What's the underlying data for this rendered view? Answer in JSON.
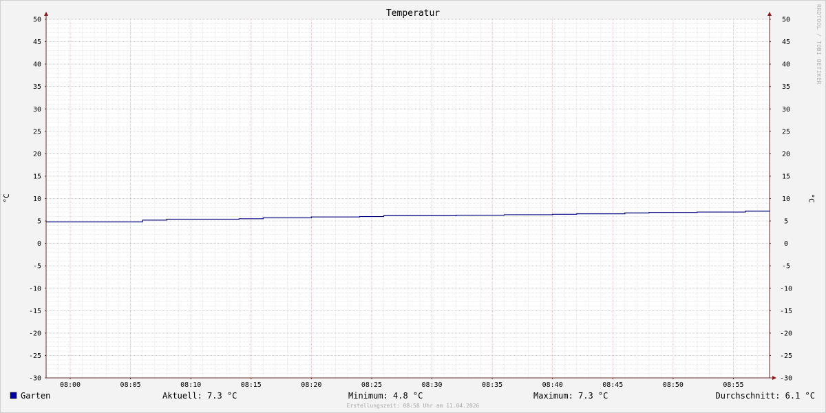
{
  "chart_data": {
    "type": "line",
    "title": "Temperatur",
    "ylabel": "°C",
    "ylim": [
      -30,
      50
    ],
    "yticks": [
      50,
      45,
      40,
      35,
      30,
      25,
      20,
      15,
      10,
      5,
      0,
      -5,
      -10,
      -15,
      -20,
      -25,
      -30
    ],
    "xlim": [
      "07:58",
      "08:58"
    ],
    "xticks": [
      "08:00",
      "08:05",
      "08:10",
      "08:15",
      "08:20",
      "08:25",
      "08:30",
      "08:35",
      "08:40",
      "08:45",
      "08:50",
      "08:55"
    ],
    "grid": true,
    "series": [
      {
        "name": "Garten",
        "color": "#000080",
        "step": true,
        "x": [
          "07:58",
          "08:06",
          "08:08",
          "08:14",
          "08:16",
          "08:20",
          "08:24",
          "08:26",
          "08:32",
          "08:36",
          "08:40",
          "08:42",
          "08:46",
          "08:48",
          "08:52",
          "08:56",
          "08:58"
        ],
        "y": [
          4.8,
          5.2,
          5.4,
          5.5,
          5.7,
          5.9,
          6.0,
          6.2,
          6.3,
          6.4,
          6.5,
          6.6,
          6.8,
          6.9,
          7.0,
          7.2,
          7.3
        ]
      }
    ],
    "legend": {
      "swatch_color": "#0000a0",
      "label": "Garten",
      "aktuell": "Aktuell: 7.3 °C",
      "minimum": "Minimum: 4.8 °C",
      "maximum": "Maximum: 7.3 °C",
      "durchschnitt": "Durchschnitt: 6.1 °C"
    },
    "watermark": "RRDTOOL / TOBI OETIKER",
    "footer": "Erstellungszeit: 08:58 Uhr am 11.04.2026"
  },
  "colors": {
    "background": "#f3f3f3",
    "plot_background": "#ffffff",
    "major_grid": "#e8a0a0",
    "minor_grid": "#d8d8d8",
    "axis": "#6a2a2a",
    "arrow": "#8b1a1a",
    "line": "#000080"
  }
}
